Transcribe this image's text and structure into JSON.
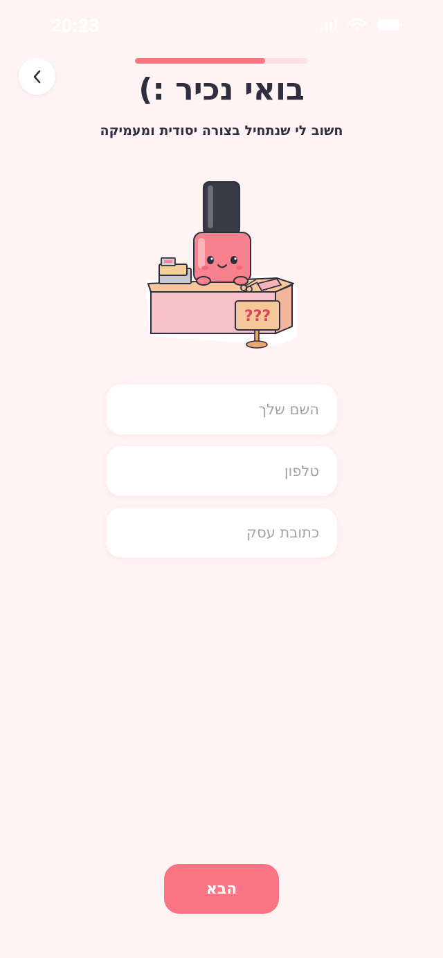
{
  "status_bar": {
    "time": "20:23"
  },
  "progress": {
    "value": 0.75
  },
  "header": {
    "title": "בואי נכיר :)",
    "subtitle": "חשוב לי שנתחיל בצורה יסודית ומעמיקה"
  },
  "illustration": {
    "sign_text": "???"
  },
  "form": {
    "name_placeholder": "השם שלך",
    "phone_placeholder": "טלפון",
    "address_placeholder": "כתובת עסק"
  },
  "next_button": {
    "label": "הבא"
  },
  "colors": {
    "accent": "#f97583",
    "track": "#fde0e3",
    "background": "#fff3f4"
  }
}
